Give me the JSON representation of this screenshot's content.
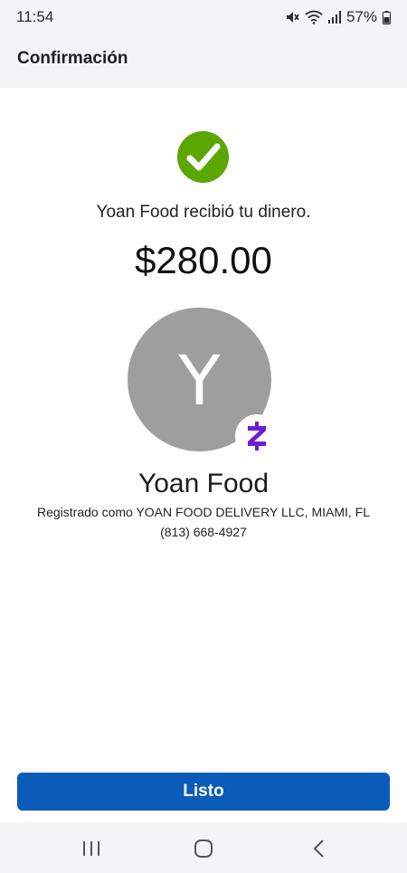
{
  "status_bar": {
    "time": "11:54",
    "battery": "57%",
    "icons": [
      "mute-icon",
      "wifi-icon",
      "signal-icon",
      "battery-icon"
    ]
  },
  "header": {
    "title": "Confirmación"
  },
  "confirmation": {
    "check_icon": "checkmark-circle-icon",
    "check_color": "#5aa700",
    "message": "Yoan Food recibió tu dinero.",
    "amount": "$280.00"
  },
  "recipient": {
    "avatar_letter": "Y",
    "avatar_color": "#9e9e9e",
    "badge_icon": "zelle-icon",
    "badge_color": "#6d1ed4",
    "name": "Yoan Food",
    "registered": "Registrado como YOAN FOOD DELIVERY LLC, MIAMI, FL",
    "phone": "(813) 668-4927"
  },
  "actions": {
    "done_label": "Listo",
    "accent": "#0b5cb8"
  },
  "nav": {
    "icons": [
      "recent-apps-icon",
      "home-icon",
      "back-icon"
    ]
  }
}
